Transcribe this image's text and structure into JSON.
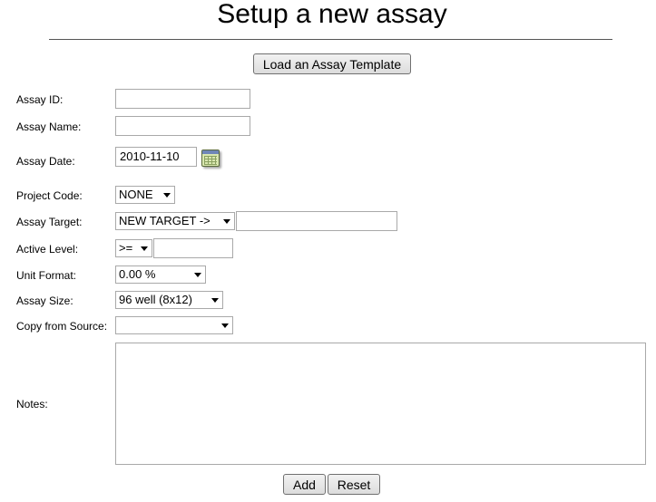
{
  "page": {
    "title": "Setup a new assay"
  },
  "buttons": {
    "load_template": "Load an Assay Template",
    "add": "Add",
    "reset": "Reset"
  },
  "form": {
    "assay_id": {
      "label": "Assay ID:",
      "value": ""
    },
    "assay_name": {
      "label": "Assay Name:",
      "value": ""
    },
    "assay_date": {
      "label": "Assay Date:",
      "value": "2010-11-10",
      "icon": "calendar-icon"
    },
    "project_code": {
      "label": "Project Code:",
      "selected": "NONE"
    },
    "assay_target": {
      "label": "Assay Target:",
      "selected": "NEW TARGET ->",
      "value": ""
    },
    "active_level": {
      "label": "Active Level:",
      "selected": ">=",
      "value": ""
    },
    "unit_format": {
      "label": "Unit Format:",
      "selected": "0.00 %"
    },
    "assay_size": {
      "label": "Assay Size:",
      "selected": "96 well (8x12)"
    },
    "copy_from_source": {
      "label": "Copy from Source:",
      "selected": ""
    },
    "notes": {
      "label": "Notes:",
      "value": ""
    }
  }
}
